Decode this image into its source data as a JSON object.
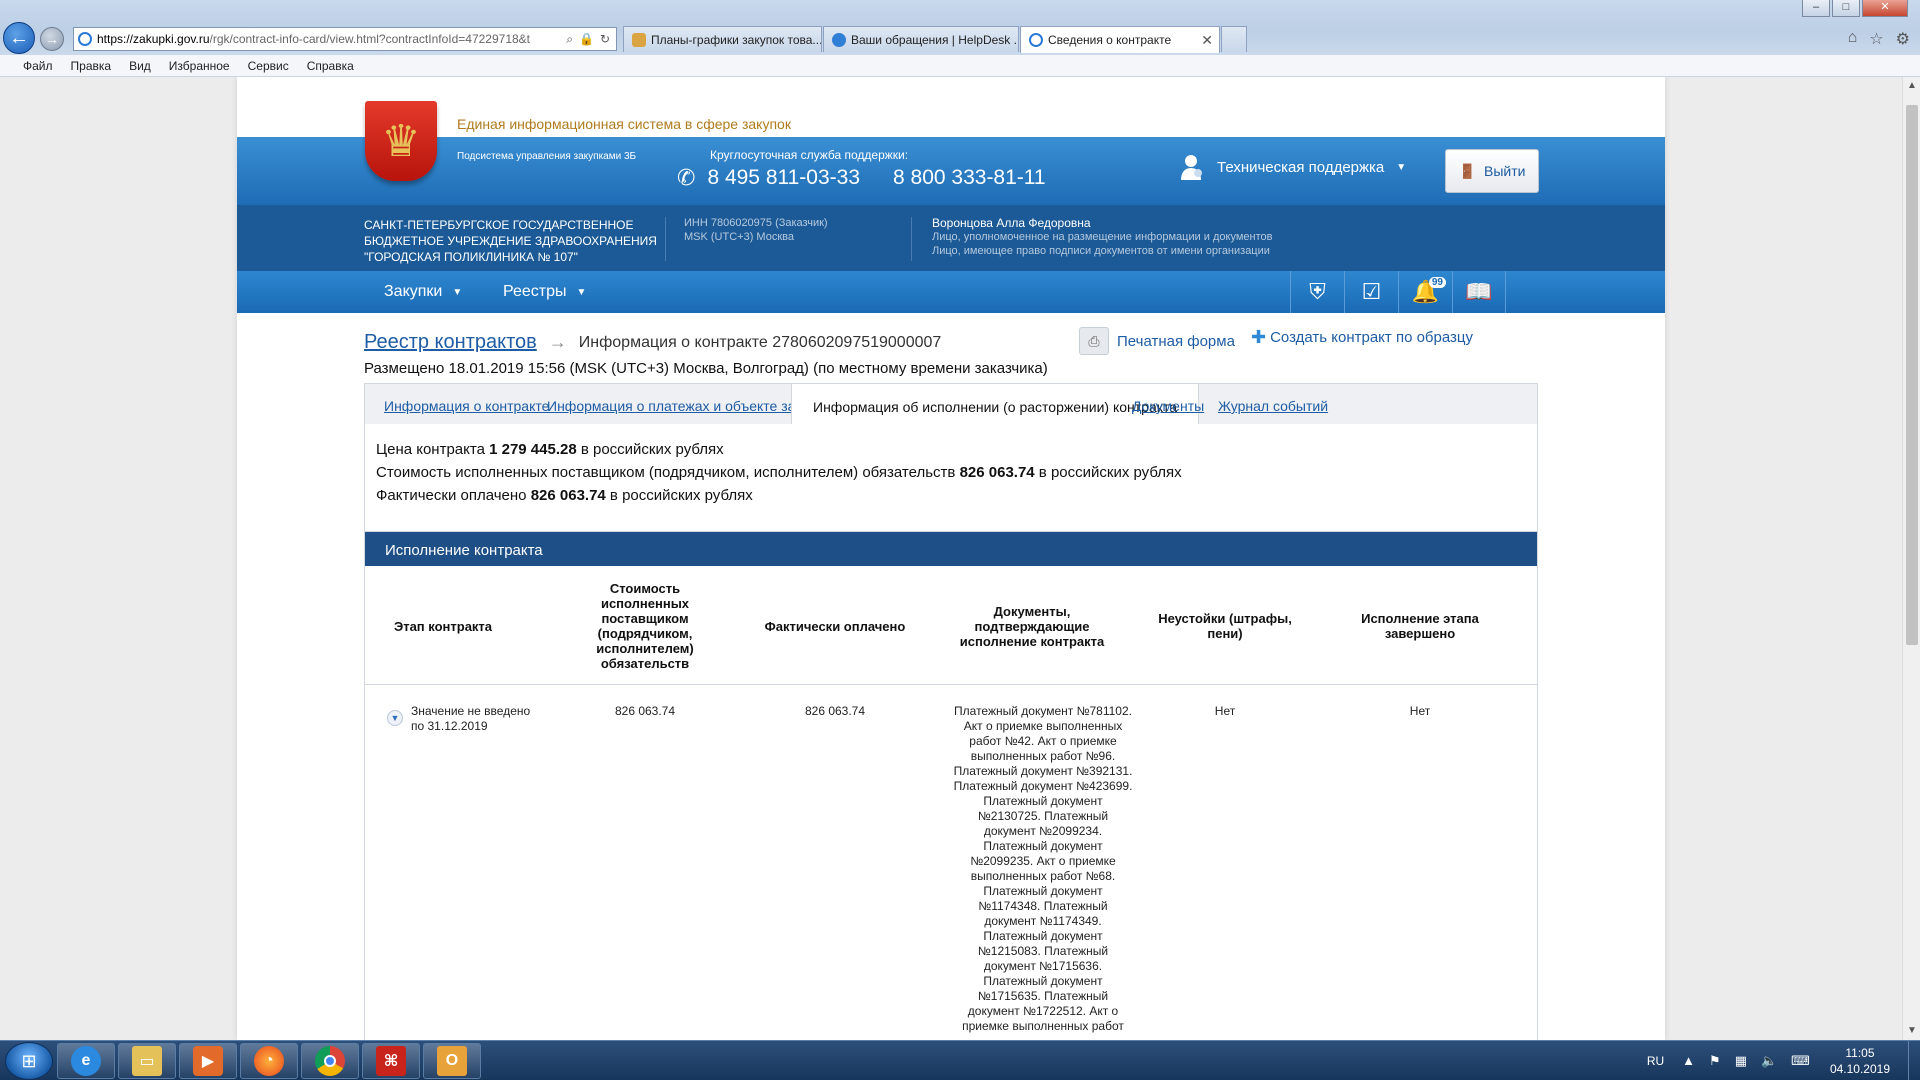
{
  "browser": {
    "url_host": "https://zakupki.gov.ru",
    "url_rest": "/rgk/contract-info-card/view.html?contractInfoId=47229718&t",
    "tabs": [
      {
        "label": "Планы-графики закупок това..."
      },
      {
        "label": "Ваши обращения | HelpDesk ..."
      },
      {
        "label": "Сведения о контракте"
      }
    ],
    "menu": [
      "Файл",
      "Правка",
      "Вид",
      "Избранное",
      "Сервис",
      "Справка"
    ]
  },
  "header": {
    "portal_title": "Единая информационная система в сфере закупок",
    "subsystem": "Подсистема управления закупками 3Б",
    "support_label": "Круглосуточная служба поддержки:",
    "phone1": "8 495 811-03-33",
    "phone2": "8 800 333-81-11",
    "tech_support": "Техническая поддержка",
    "logout": "Выйти"
  },
  "org": {
    "name": "САНКТ-ПЕТЕРБУРГСКОЕ ГОСУДАРСТВЕННОЕ БЮДЖЕТНОЕ УЧРЕЖДЕНИЕ ЗДРАВООХРАНЕНИЯ \"ГОРОДСКАЯ ПОЛИКЛИНИКА № 107\"",
    "inn": "ИНН 7806020975 (Заказчик)",
    "tz": "MSK (UTC+3) Москва",
    "user_name": "Воронцова Алла Федоровна",
    "user_role1": "Лицо, уполномоченное на размещение информации и документов",
    "user_role2": "Лицо, имеющее право подписи документов от имени организации"
  },
  "nav": {
    "item1": "Закупки",
    "item2": "Реестры",
    "notif_count": "99"
  },
  "content": {
    "crumb_registry": "Реестр контрактов",
    "crumb_current": "Информация о контракте 2780602097519000007",
    "print_label": "Печатная форма",
    "create_label": "Создать контракт по образцу",
    "placed": "Размещено 18.01.2019 15:56 (MSK (UTC+3) Москва, Волгоград) (по местному времени заказчика)",
    "tabs": {
      "t1": "Информация о контракте",
      "t2": "Информация о платежах и объекте закупки",
      "t3": "Информация об исполнении (о расторжении) контракта",
      "t4": "Документы",
      "t5": "Журнал событий"
    },
    "price": {
      "l1_pre": "Цена контракта ",
      "l1_val": "1 279 445.28",
      "l1_post": " в российских рублях",
      "l2_pre": "Стоимость исполненных поставщиком (подрядчиком, исполнителем) обязательств ",
      "l2_val": "826 063.74",
      "l2_post": " в российских рублях",
      "l3_pre": "Фактически оплачено ",
      "l3_val": "826 063.74",
      "l3_post": " в российских рублях"
    },
    "exec": {
      "title": "Исполнение контракта",
      "headers": {
        "h1": "Этап контракта",
        "h2": "Стоимость исполненных поставщиком (подрядчиком, исполнителем) обязательств",
        "h3": "Фактически оплачено",
        "h4": "Документы, подтверждающие исполнение контракта",
        "h5": "Неустойки (штрафы, пени)",
        "h6": "Исполнение этапа завершено"
      },
      "row": {
        "stage": "Значение не введено по 31.12.2019",
        "cost": "826 063.74",
        "paid": "826 063.74",
        "docs": "Платежный документ №781102. Акт о приемке выполненных работ №42. Акт о приемке выполненных работ №96. Платежный документ №392131. Платежный документ №423699. Платежный документ №2130725. Платежный документ №2099234. Платежный документ №2099235. Акт о приемке выполненных работ №68. Платежный документ №1174348. Платежный документ №1174349. Платежный документ №1215083. Платежный документ №1715636. Платежный документ №1715635. Платежный документ №1722512. Акт о приемке выполненных работ",
        "penalties": "Нет",
        "completed": "Нет"
      }
    }
  },
  "taskbar": {
    "lang": "RU",
    "time": "11:05",
    "date": "04.10.2019"
  }
}
